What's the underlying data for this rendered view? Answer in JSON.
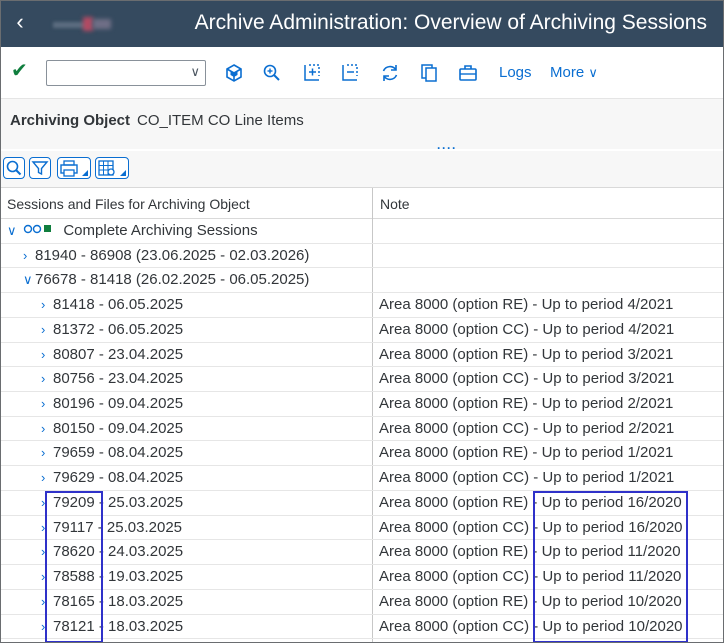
{
  "titlebar": {
    "title": "Archive Administration: Overview of Archiving Sessions"
  },
  "toolbar": {
    "command_value": "",
    "logs_label": "Logs",
    "more_label": "More"
  },
  "object_header": {
    "label": "Archiving Object",
    "value": "CO_ITEM CO Line Items"
  },
  "table": {
    "col1_header": "Sessions and Files for Archiving Object",
    "col2_header": "Note",
    "root_label": "Complete Archiving Sessions",
    "rows": [
      {
        "text": "81940 - 86908 (23.06.2025 - 02.03.2026)",
        "note": ""
      },
      {
        "text": "76678 - 81418 (26.02.2025 - 06.05.2025)",
        "note": ""
      },
      {
        "text": "81418 - 06.05.2025",
        "note": "Area 8000 (option RE) - Up to period 4/2021"
      },
      {
        "text": "81372 - 06.05.2025",
        "note": "Area 8000 (option CC) - Up to period 4/2021"
      },
      {
        "text": "80807 - 23.04.2025",
        "note": "Area 8000 (option RE) - Up to period 3/2021"
      },
      {
        "text": "80756 - 23.04.2025",
        "note": "Area 8000 (option CC) - Up to period 3/2021"
      },
      {
        "text": "80196 - 09.04.2025",
        "note": "Area 8000 (option RE) - Up to period 2/2021"
      },
      {
        "text": "80150 - 09.04.2025",
        "note": "Area 8000 (option CC) - Up to period 2/2021"
      },
      {
        "text": "79659 - 08.04.2025",
        "note": "Area 8000 (option RE) - Up to period 1/2021"
      },
      {
        "text": "79629 - 08.04.2025",
        "note": "Area 8000 (option CC) - Up to period 1/2021"
      },
      {
        "text": "79209 - 25.03.2025",
        "note": "Area 8000 (option RE) - Up to period 16/2020"
      },
      {
        "text": "79117 - 25.03.2025",
        "note": "Area 8000 (option CC) - Up to period 16/2020"
      },
      {
        "text": "78620 - 24.03.2025",
        "note": "Area 8000 (option RE) - Up to period 11/2020"
      },
      {
        "text": "78588 - 19.03.2025",
        "note": "Area 8000 (option CC) - Up to period 11/2020"
      },
      {
        "text": "78165 - 18.03.2025",
        "note": "Area 8000 (option RE) - Up to period 10/2020"
      },
      {
        "text": "78121 - 18.03.2025",
        "note": "Area 8000 (option CC) - Up to period 10/2020"
      }
    ]
  },
  "colors": {
    "shell": "#354a5f",
    "accent": "#0a6ed1",
    "success": "#107e3e",
    "highlight": "#2f31c9"
  }
}
